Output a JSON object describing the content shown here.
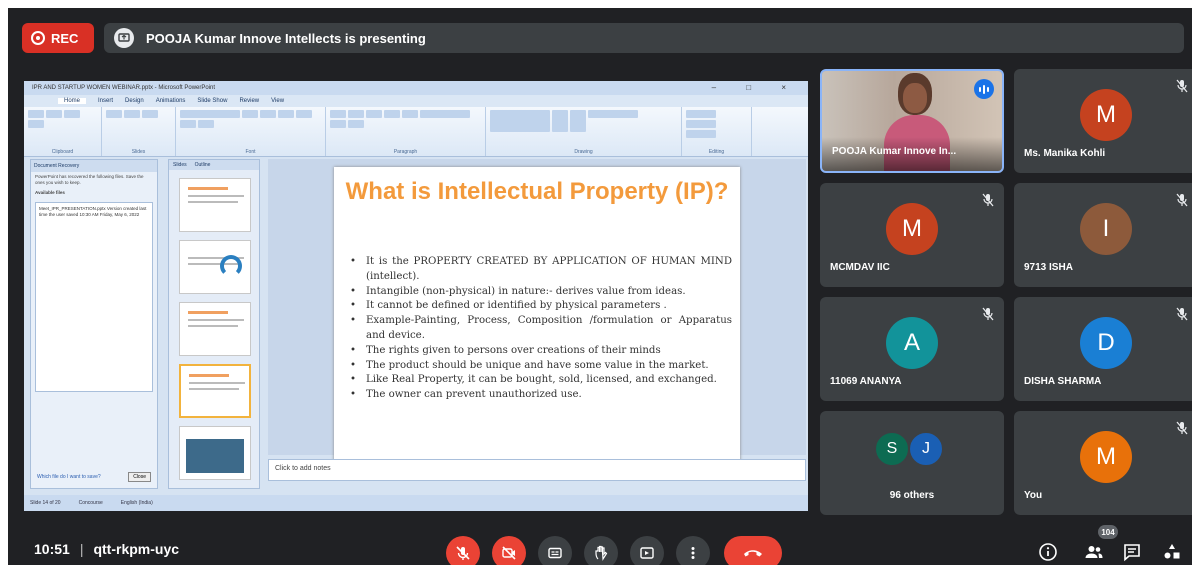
{
  "top_bar": {
    "rec_label": "REC",
    "presenting_text": "POOJA Kumar Innove Intellects is presenting"
  },
  "shared_screen": {
    "window_title": "IPR AND STARTUP WOMEN WEBINAR.pptx - Microsoft PowerPoint",
    "ribbon_tabs": [
      "Home",
      "Insert",
      "Design",
      "Animations",
      "Slide Show",
      "Review",
      "View"
    ],
    "ribbon_groups": [
      "Clipboard",
      "Slides",
      "Font",
      "Paragraph",
      "Drawing",
      "Editing"
    ],
    "task_pane": {
      "title": "Document Recovery",
      "message": "PowerPoint has recovered the following files. Save the ones you wish to keep.",
      "list_label": "Available files",
      "file_entry": "Meet_IPR_PRESENTATION.pptx  Version created last time the user saved  10:30 AM Friday, May 6, 2022",
      "link": "Which file do I want to save?",
      "close_button": "Close"
    },
    "thumb_tabs": [
      "Slides",
      "Outline"
    ],
    "slide": {
      "title": "What is Intellectual Property (IP)?",
      "bullets": [
        "It is the PROPERTY CREATED BY APPLICATION OF HUMAN MIND (intellect).",
        "Intangible (non-physical) in nature:- derives value from ideas.",
        "It cannot be defined or identified by physical parameters .",
        "Example-Painting, Process, Composition /formulation or Apparatus and device.",
        "The rights given to persons over creations of their minds",
        "The product should be unique and have some value in the market.",
        "Like Real Property, it can be bought, sold, licensed, and exchanged.",
        "The owner can prevent unauthorized use."
      ]
    },
    "notes_placeholder": "Click to add notes",
    "status_bar": [
      "Slide 14 of 20",
      "Concourse",
      "English (India)"
    ]
  },
  "participants": [
    {
      "name": "POOJA Kumar Innove In...",
      "type": "video"
    },
    {
      "name": "Ms. Manika Kohli",
      "initial": "M",
      "color": "#c5421f"
    },
    {
      "name": "MCMDAV IIC",
      "initial": "M",
      "color": "#c5421f"
    },
    {
      "name": "9713 ISHA",
      "initial": "I",
      "color": "#8d5a3b"
    },
    {
      "name": "11069 ANANYA",
      "initial": "A",
      "color": "#12939a"
    },
    {
      "name": "DISHA SHARMA",
      "initial": "D",
      "color": "#1a7fd4"
    },
    {
      "name": "You",
      "initial": "M",
      "color": "#e8710a"
    }
  ],
  "others_tile": {
    "label": "96 others",
    "avatars": [
      {
        "initial": "S",
        "color": "#0d6b52"
      },
      {
        "initial": "J",
        "color": "#1a5fb4"
      }
    ]
  },
  "bottom_bar": {
    "time": "10:51",
    "separator": "|",
    "meeting_code": "qtt-rkpm-uyc",
    "people_count": "104"
  },
  "icons": [
    "record-icon",
    "present-icon",
    "mic-off-icon",
    "camera-off-icon",
    "captions-icon",
    "raise-hand-icon",
    "present-now-icon",
    "more-options-icon",
    "hang-up-icon",
    "info-icon",
    "people-icon",
    "chat-icon",
    "activities-icon"
  ]
}
